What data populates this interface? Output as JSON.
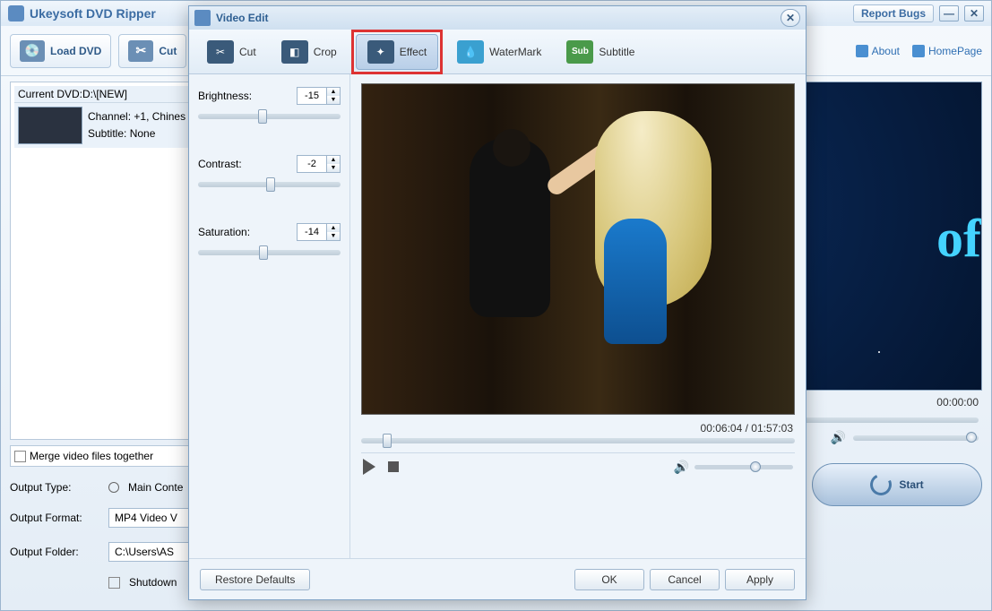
{
  "main": {
    "title": "Ukeysoft DVD Ripper",
    "report_bugs": "Report Bugs",
    "toolbar": {
      "load_dvd": "Load DVD",
      "cut": "Cut"
    },
    "links": {
      "about": "About",
      "homepage": "HomePage"
    },
    "dvd": {
      "current_label": "Current DVD:D:\\[NEW]",
      "channel_label": "Channel:",
      "channel_value": "+1, Chines",
      "subtitle_label": "Subtitle:",
      "subtitle_value": "None"
    },
    "merge_label": "Merge video files together",
    "output_type_label": "Output Type:",
    "output_type_value": "Main Conte",
    "output_format_label": "Output Format:",
    "output_format_value": "MP4 Video V",
    "output_folder_label": "Output Folder:",
    "output_folder_value": "C:\\Users\\AS",
    "shutdown_label": "Shutdown",
    "preview_time": "00:00:00",
    "start_label": "Start",
    "logo_fragment": "oft"
  },
  "dialog": {
    "title": "Video Edit",
    "tabs": {
      "cut": "Cut",
      "crop": "Crop",
      "effect": "Effect",
      "watermark": "WaterMark",
      "subtitle": "Subtitle"
    },
    "effect": {
      "brightness_label": "Brightness:",
      "brightness_value": "-15",
      "contrast_label": "Contrast:",
      "contrast_value": "-2",
      "saturation_label": "Saturation:",
      "saturation_value": "-14"
    },
    "playback": {
      "position": "00:06:04",
      "duration": "01:57:03",
      "sep": " / "
    },
    "footer": {
      "restore": "Restore Defaults",
      "ok": "OK",
      "cancel": "Cancel",
      "apply": "Apply"
    }
  }
}
